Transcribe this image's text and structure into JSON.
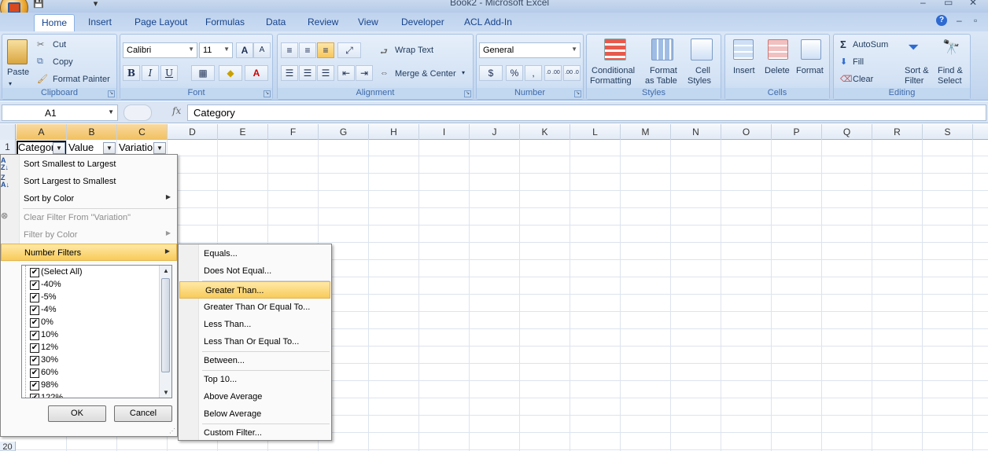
{
  "window": {
    "title": "Book2 - Microsoft Excel",
    "controls": [
      "–",
      "▭",
      "✕"
    ]
  },
  "tabs": [
    "Home",
    "Insert",
    "Page Layout",
    "Formulas",
    "Data",
    "Review",
    "View",
    "Developer",
    "ACL Add-In"
  ],
  "ribbon": {
    "clipboard": {
      "label": "Clipboard",
      "paste": "Paste",
      "cut": "Cut",
      "copy": "Copy",
      "format_painter": "Format Painter"
    },
    "font": {
      "label": "Font",
      "font_name": "Calibri",
      "font_size": "11",
      "bold": "B",
      "italic": "I",
      "underline": "U",
      "grow": "A",
      "shrink": "A"
    },
    "alignment": {
      "label": "Alignment",
      "wrap_text": "Wrap Text",
      "merge_center": "Merge & Center"
    },
    "number": {
      "label": "Number",
      "format": "General",
      "currency": "$",
      "percent": "%",
      "comma": ",",
      "inc_dec": ".0 .00",
      "dec_dec": ".00 .0"
    },
    "styles": {
      "label": "Styles",
      "conditional": "Conditional",
      "formatting": "Formatting",
      "format": "Format",
      "as_table": "as Table",
      "cell": "Cell",
      "styles": "Styles"
    },
    "cells": {
      "label": "Cells",
      "insert": "Insert",
      "delete": "Delete",
      "format": "Format"
    },
    "editing": {
      "label": "Editing",
      "autosum": "AutoSum",
      "fill": "Fill",
      "clear": "Clear",
      "sort_filter_1": "Sort &",
      "sort_filter_2": "Filter",
      "find_select_1": "Find &",
      "find_select_2": "Select"
    }
  },
  "formula_bar": {
    "name_box": "A1",
    "fx": "fx",
    "content": "Category"
  },
  "columns": [
    "A",
    "B",
    "C",
    "D",
    "E",
    "F",
    "G",
    "H",
    "I",
    "J",
    "K",
    "L",
    "M",
    "N",
    "O",
    "P",
    "Q",
    "R",
    "S"
  ],
  "rows": [
    "1",
    "20"
  ],
  "cells": {
    "A1": "Category",
    "B1": "Value",
    "C1": "Variation"
  },
  "filter_menu": {
    "sort_asc": "Sort Smallest to Largest",
    "sort_desc": "Sort Largest to Smallest",
    "sort_color": "Sort by Color",
    "clear_filter": "Clear Filter From \"Variation\"",
    "filter_color": "Filter by Color",
    "number_filters": "Number Filters",
    "values": [
      "(Select All)",
      "-40%",
      "-5%",
      "-4%",
      "0%",
      "10%",
      "12%",
      "30%",
      "60%",
      "98%",
      "122%"
    ],
    "ok": "OK",
    "cancel": "Cancel"
  },
  "number_filters_menu": [
    "Equals...",
    "Does Not Equal...",
    "Greater Than...",
    "Greater Than Or Equal To...",
    "Less Than...",
    "Less Than Or Equal To...",
    "Between...",
    "Top 10...",
    "Above Average",
    "Below Average",
    "Custom Filter..."
  ]
}
